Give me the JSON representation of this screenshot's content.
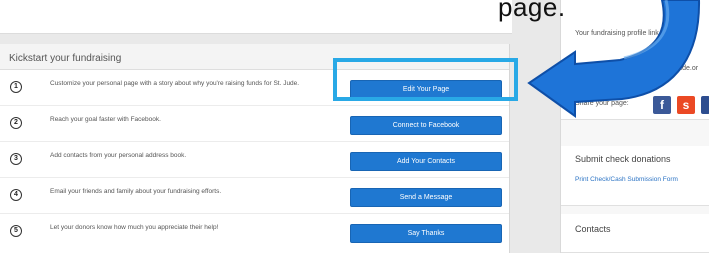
{
  "page_word": "page.",
  "panel": {
    "header": "Kickstart your fundraising",
    "tasks": [
      {
        "num": "1",
        "text": "Customize your personal page with a story about why you're raising funds for St. Jude.",
        "button": "Edit Your Page"
      },
      {
        "num": "2",
        "text": "Reach your goal faster with Facebook.",
        "button": "Connect to Facebook"
      },
      {
        "num": "3",
        "text": "Add contacts from your personal address book.",
        "button": "Add Your Contacts"
      },
      {
        "num": "4",
        "text": "Email your friends and family about your fundraising efforts.",
        "button": "Send a Message"
      },
      {
        "num": "5",
        "text": "Let your donors know how much you appreciate their help!",
        "button": "Say Thanks"
      }
    ]
  },
  "right": {
    "profile_text": "Your fundraising profile link",
    "profile_url": "fundraising stjude.or",
    "share_label": "Share your page:",
    "social": [
      {
        "name": "facebook",
        "glyph": "f",
        "color": "#3b5998"
      },
      {
        "name": "stumbleupon",
        "glyph": "s",
        "color": "#eb4924"
      },
      {
        "name": "other",
        "glyph": "",
        "color": "#2d4d8f"
      }
    ],
    "check_title": "Submit check donations",
    "check_link": "Print Check/Cash Submission Form",
    "contacts_title": "Contacts"
  },
  "colors": {
    "button": "#1f78d1",
    "highlight": "#29a9e6",
    "arrow": "#1e74d8"
  }
}
